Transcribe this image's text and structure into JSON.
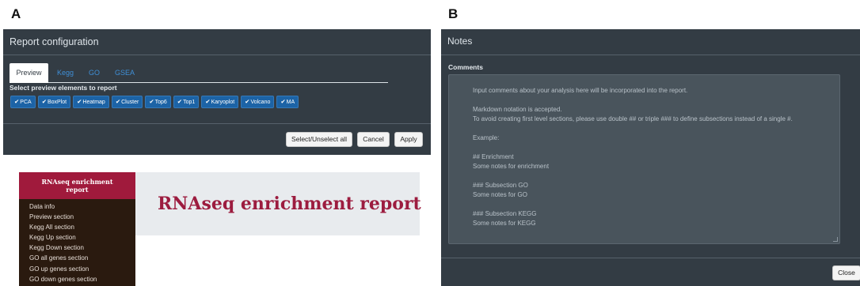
{
  "panel_labels": {
    "a": "A",
    "b": "B"
  },
  "config_modal": {
    "title": "Report configuration",
    "tabs": [
      {
        "label": "Preview",
        "active": true
      },
      {
        "label": "Kegg",
        "active": false
      },
      {
        "label": "GO",
        "active": false
      },
      {
        "label": "GSEA",
        "active": false
      }
    ],
    "select_label": "Select preview elements to report",
    "chips": [
      "PCA",
      "BoxPlot",
      "Heatmap",
      "Cluster",
      "Top6",
      "Top1",
      "Karyoplot",
      "Volcano",
      "MA"
    ],
    "chip_check": "✔",
    "buttons": {
      "select_all": "Select/Unselect all",
      "cancel": "Cancel",
      "apply": "Apply"
    }
  },
  "report_preview": {
    "sidebar_title_line1": "RNAseq enrichment",
    "sidebar_title_line2": "report",
    "nav": [
      "Data info",
      "Preview section",
      "Kegg All section",
      "Kegg Up section",
      "Kegg Down section",
      "GO all genes section",
      "GO up genes section",
      "GO down genes section"
    ],
    "main_title": "RNAseq enrichment report"
  },
  "notes_modal": {
    "title": "Notes",
    "comments_label": "Comments",
    "comments_lines": [
      "Input comments about your analysis here will be incorporated into the report.",
      "",
      "Markdown notation is accepted.",
      "To avoid creating first level sections, please use double ## or triple ### to define subsections instead of a single #.",
      "",
      "Example:",
      "",
      "## Enrichment",
      "Some notes for enrichment",
      "",
      "### Subsection GO",
      "Some notes for GO",
      "",
      "### Subsection KEGG",
      "Some notes for KEGG"
    ],
    "close_label": "Close"
  }
}
